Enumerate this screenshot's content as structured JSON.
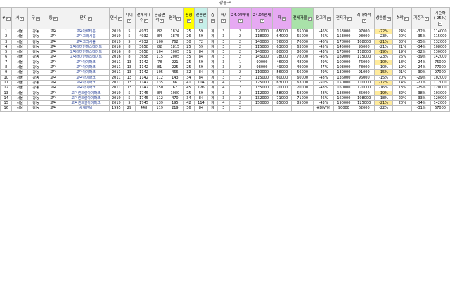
{
  "title": "강동구",
  "headers": [
    "#",
    "시",
    "구",
    "동",
    "단지",
    "연식",
    "나이",
    "전체세대수",
    "공급면적",
    "면적",
    "평형",
    "전용면",
    "층",
    "제/",
    "24.04매매",
    "24.04전세",
    "재",
    "전세가율",
    "전고가",
    "전저가",
    "최대하락",
    "상승률",
    "하락",
    "기준가",
    "기준하(-25%)"
  ],
  "rows": [
    [
      "1",
      "서울",
      "강동",
      "고덕",
      "고덕아르테온",
      "2019",
      "5",
      "4932",
      "82",
      "1824",
      "25",
      "59",
      "계",
      "3",
      "2",
      "120000",
      "65000",
      "65000",
      "-46%",
      "153000",
      "97000",
      "-22%",
      "24%",
      "-32%",
      "114000",
      "N"
    ],
    [
      "2",
      "서울",
      "강동",
      "고덕",
      "고덕그라시움",
      "2019",
      "5",
      "4932",
      "84",
      "1875",
      "26",
      "59",
      "계",
      "3",
      "2",
      "118000",
      "64000",
      "65000",
      "-46%",
      "153000",
      "98000",
      "-23%",
      "20%",
      "-35%",
      "115000",
      "N"
    ],
    [
      "3",
      "서울",
      "강동",
      "고덕",
      "고덕그라시움",
      "2019",
      "5",
      "4932",
      "100",
      "762",
      "30",
      "72",
      "계",
      "3",
      "2",
      "140000",
      "76000",
      "76000",
      "-46%",
      "178000",
      "108000",
      "-21%",
      "30%",
      "-35%",
      "132000",
      "N"
    ],
    [
      "4",
      "서울",
      "강동",
      "고덕",
      "고덕래미안힐스테이트",
      "2016",
      "8",
      "3658",
      "82",
      "1815",
      "25",
      "59",
      "계",
      "3",
      "2",
      "115000",
      "63000",
      "63000",
      "-45%",
      "145000",
      "95000",
      "-21%",
      "21%",
      "-34%",
      "108000",
      "N"
    ],
    [
      "5",
      "서울",
      "강동",
      "고덕",
      "고덕래미안힐스테이트",
      "2016",
      "8",
      "3658",
      "104",
      "1005",
      "31",
      "84",
      "계",
      "3",
      "2",
      "140000",
      "80000",
      "80000",
      "-43%",
      "173000",
      "118000",
      "-19%",
      "19%",
      "-32%",
      "130000",
      "N"
    ],
    [
      "6",
      "서울",
      "강동",
      "고덕",
      "고덕래미안힐스테이트",
      "2016",
      "8",
      "3658",
      "115",
      "2005",
      "35",
      "84",
      "계",
      "3",
      "2",
      "145000",
      "78000",
      "78000",
      "-46%",
      "189000",
      "115000",
      "-23%",
      "26%",
      "-39%",
      "142000",
      "N"
    ],
    [
      "7",
      "서울",
      "강동",
      "고덕",
      "고덕아이파크",
      "2011",
      "13",
      "1142",
      "78",
      "221",
      "25",
      "59",
      "계",
      "3",
      "1",
      "90000",
      "46000",
      "48000",
      "-49%",
      "100000",
      "76000",
      "-10%",
      "18%",
      "-24%",
      "75000",
      "N"
    ],
    [
      "8",
      "서울",
      "강동",
      "고덕",
      "고덕아이파크",
      "2011",
      "13",
      "1142",
      "81",
      "225",
      "25",
      "59",
      "계",
      "3",
      "2",
      "93000",
      "49000",
      "49000",
      "-47%",
      "103000",
      "78000",
      "-10%",
      "19%",
      "-24%",
      "77000",
      "N"
    ],
    [
      "9",
      "서울",
      "강동",
      "고덕",
      "고덕아이파크",
      "2011",
      "13",
      "1142",
      "105",
      "466",
      "32",
      "84",
      "계",
      "3",
      "2",
      "110000",
      "56000",
      "56000",
      "-49%",
      "130000",
      "91000",
      "-15%",
      "21%",
      "-30%",
      "97000",
      "N"
    ],
    [
      "10",
      "서울",
      "강동",
      "고덕",
      "고덕아이파크",
      "2011",
      "13",
      "1142",
      "112",
      "143",
      "34",
      "84",
      "계",
      "3",
      "2",
      "115000",
      "60000",
      "60000",
      "-48%",
      "136000",
      "96000",
      "-15%",
      "20%",
      "-29%",
      "102000",
      "N"
    ],
    [
      "11",
      "서울",
      "강동",
      "고덕",
      "고덕아이파크",
      "2011",
      "13",
      "1142",
      "135",
      "86",
      "41",
      "114",
      "계",
      "4",
      "2",
      "125000",
      "63000",
      "63000",
      "-50%",
      "150000",
      "110000",
      "-17%",
      "14%",
      "-27%",
      "112000",
      "N"
    ],
    [
      "12",
      "서울",
      "강동",
      "고덕",
      "고덕아이파크",
      "2011",
      "13",
      "1142",
      "150",
      "62",
      "45",
      "126",
      "계",
      "4",
      "2",
      "135000",
      "70000",
      "70000",
      "-48%",
      "160000",
      "120000",
      "-16%",
      "13%",
      "-25%",
      "120000",
      "N"
    ],
    [
      "13",
      "서울",
      "강동",
      "고덕",
      "고덕센트럴아이파크",
      "2019",
      "5",
      "1745",
      "84",
      "1080",
      "25",
      "59",
      "계",
      "3",
      "2",
      "112000",
      "58000",
      "58000",
      "-48%",
      "138000",
      "85000",
      "-19%",
      "32%",
      "-38%",
      "103000",
      "N"
    ],
    [
      "14",
      "서울",
      "강동",
      "고덕",
      "고덕센트럴아이파크",
      "2019",
      "5",
      "1745",
      "112",
      "470",
      "34",
      "84",
      "계",
      "3",
      "2",
      "132000",
      "71000",
      "71000",
      "-46%",
      "160000",
      "108000",
      "-18%",
      "22%",
      "-33%",
      "120000",
      "N"
    ],
    [
      "15",
      "서울",
      "강동",
      "고덕",
      "고덕센트럴아이파크",
      "2019",
      "5",
      "1745",
      "139",
      "195",
      "42",
      "114",
      "계",
      "4",
      "2",
      "150000",
      "85000",
      "85000",
      "-43%",
      "190000",
      "125000",
      "-21%",
      "20%",
      "-34%",
      "142000",
      "N"
    ],
    [
      "16",
      "서울",
      "강동",
      "고덕",
      "세계한옥",
      "1995",
      "29",
      "448",
      "119",
      "219",
      "36",
      "84",
      "계",
      "3",
      "2",
      "",
      "",
      "",
      "#DIV/0!",
      "90000",
      "62000",
      "-22%",
      "",
      "-31%",
      "67000",
      "N"
    ]
  ]
}
